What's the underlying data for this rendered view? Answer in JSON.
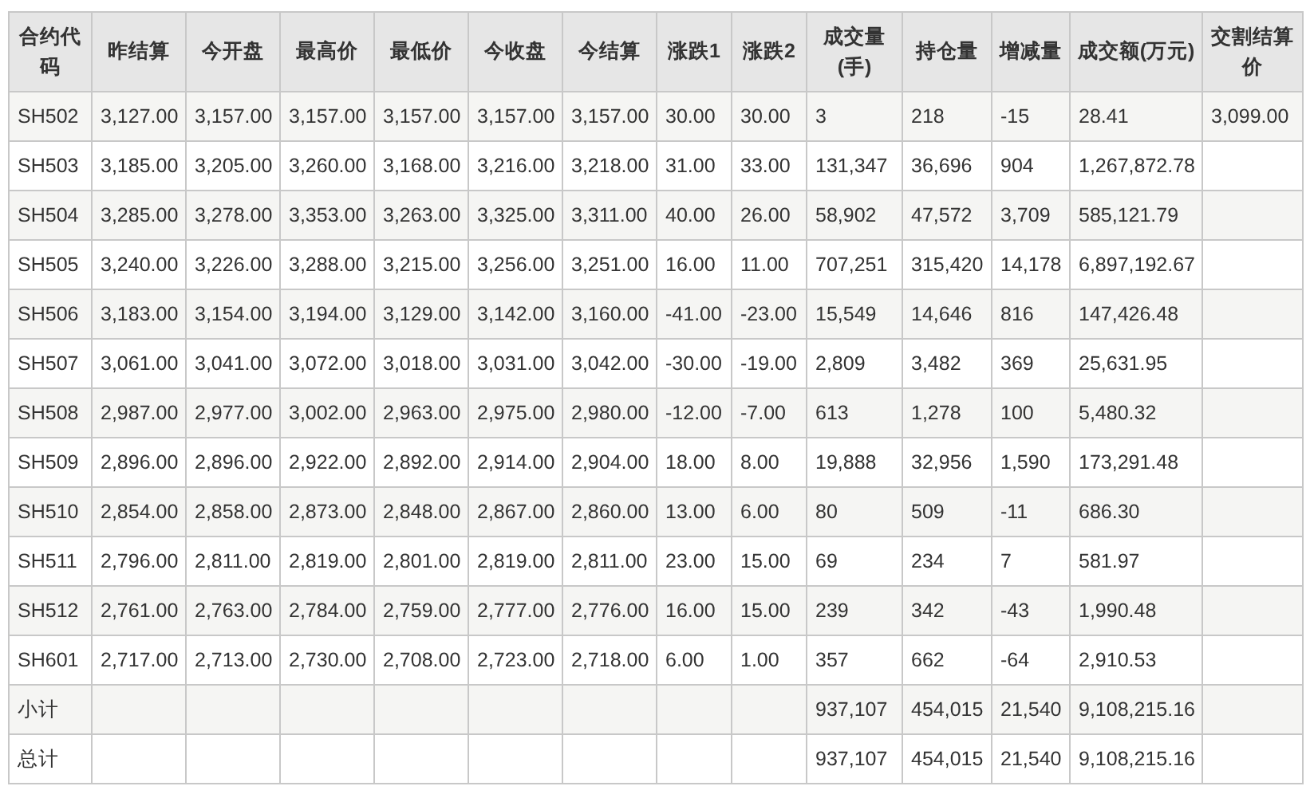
{
  "table": {
    "columns": [
      "合约代码",
      "昨结算",
      "今开盘",
      "最高价",
      "最低价",
      "今收盘",
      "今结算",
      "涨跌1",
      "涨跌2",
      "成交量(手)",
      "持仓量",
      "增减量",
      "成交额(万元)",
      "交割结算价"
    ],
    "rows": [
      [
        "SH502",
        "3,127.00",
        "3,157.00",
        "3,157.00",
        "3,157.00",
        "3,157.00",
        "3,157.00",
        "30.00",
        "30.00",
        "3",
        "218",
        "-15",
        "28.41",
        "3,099.00"
      ],
      [
        "SH503",
        "3,185.00",
        "3,205.00",
        "3,260.00",
        "3,168.00",
        "3,216.00",
        "3,218.00",
        "31.00",
        "33.00",
        "131,347",
        "36,696",
        "904",
        "1,267,872.78",
        null
      ],
      [
        "SH504",
        "3,285.00",
        "3,278.00",
        "3,353.00",
        "3,263.00",
        "3,325.00",
        "3,311.00",
        "40.00",
        "26.00",
        "58,902",
        "47,572",
        "3,709",
        "585,121.79",
        null
      ],
      [
        "SH505",
        "3,240.00",
        "3,226.00",
        "3,288.00",
        "3,215.00",
        "3,256.00",
        "3,251.00",
        "16.00",
        "11.00",
        "707,251",
        "315,420",
        "14,178",
        "6,897,192.67",
        null
      ],
      [
        "SH506",
        "3,183.00",
        "3,154.00",
        "3,194.00",
        "3,129.00",
        "3,142.00",
        "3,160.00",
        "-41.00",
        "-23.00",
        "15,549",
        "14,646",
        "816",
        "147,426.48",
        null
      ],
      [
        "SH507",
        "3,061.00",
        "3,041.00",
        "3,072.00",
        "3,018.00",
        "3,031.00",
        "3,042.00",
        "-30.00",
        "-19.00",
        "2,809",
        "3,482",
        "369",
        "25,631.95",
        null
      ],
      [
        "SH508",
        "2,987.00",
        "2,977.00",
        "3,002.00",
        "2,963.00",
        "2,975.00",
        "2,980.00",
        "-12.00",
        "-7.00",
        "613",
        "1,278",
        "100",
        "5,480.32",
        null
      ],
      [
        "SH509",
        "2,896.00",
        "2,896.00",
        "2,922.00",
        "2,892.00",
        "2,914.00",
        "2,904.00",
        "18.00",
        "8.00",
        "19,888",
        "32,956",
        "1,590",
        "173,291.48",
        null
      ],
      [
        "SH510",
        "2,854.00",
        "2,858.00",
        "2,873.00",
        "2,848.00",
        "2,867.00",
        "2,860.00",
        "13.00",
        "6.00",
        "80",
        "509",
        "-11",
        "686.30",
        null
      ],
      [
        "SH511",
        "2,796.00",
        "2,811.00",
        "2,819.00",
        "2,801.00",
        "2,819.00",
        "2,811.00",
        "23.00",
        "15.00",
        "69",
        "234",
        "7",
        "581.97",
        null
      ],
      [
        "SH512",
        "2,761.00",
        "2,763.00",
        "2,784.00",
        "2,759.00",
        "2,777.00",
        "2,776.00",
        "16.00",
        "15.00",
        "239",
        "342",
        "-43",
        "1,990.48",
        null
      ],
      [
        "SH601",
        "2,717.00",
        "2,713.00",
        "2,730.00",
        "2,708.00",
        "2,723.00",
        "2,718.00",
        "6.00",
        "1.00",
        "357",
        "662",
        "-64",
        "2,910.53",
        null
      ],
      [
        "小计",
        null,
        null,
        null,
        null,
        null,
        null,
        null,
        null,
        "937,107",
        "454,015",
        "21,540",
        "9,108,215.16",
        null
      ],
      [
        "总计",
        null,
        null,
        null,
        null,
        null,
        null,
        null,
        null,
        "937,107",
        "454,015",
        "21,540",
        "9,108,215.16",
        null
      ]
    ]
  }
}
